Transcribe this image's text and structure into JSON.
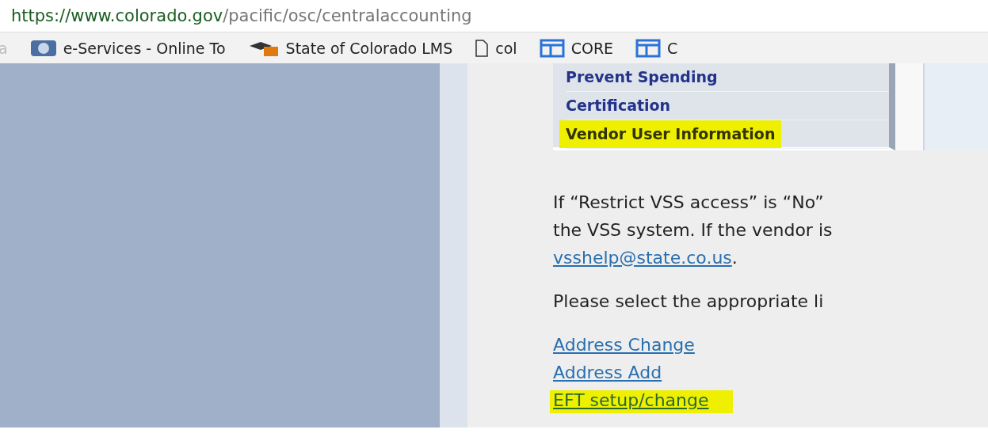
{
  "address_bar": {
    "domain": "https://www.colorado.gov",
    "path": "/pacific/osc/centralaccounting"
  },
  "bookmarks": [
    {
      "label": "a",
      "kind": "faded"
    },
    {
      "label": "e-Services - Online To",
      "kind": "seal"
    },
    {
      "label": "State of Colorado LMS",
      "kind": "cap"
    },
    {
      "label": "col",
      "kind": "page"
    },
    {
      "label": "CORE",
      "kind": "table"
    },
    {
      "label": "C",
      "kind": "table"
    }
  ],
  "menu": [
    {
      "label": "Prevent Spending",
      "highlighted": false
    },
    {
      "label": "Certification",
      "highlighted": false
    },
    {
      "label": "Vendor User Information",
      "highlighted": true
    }
  ],
  "paragraph": {
    "lines": [
      "If “Restrict VSS access” is “No”",
      "the VSS system. If the vendor is"
    ],
    "link": "vsshelp@state.co.us",
    "after_link": "."
  },
  "instruction": "Please select the appropriate li",
  "links": [
    {
      "label": "Address Change",
      "highlighted": false
    },
    {
      "label": "Address Add",
      "highlighted": false
    },
    {
      "label": "EFT setup/change",
      "highlighted": true
    }
  ]
}
